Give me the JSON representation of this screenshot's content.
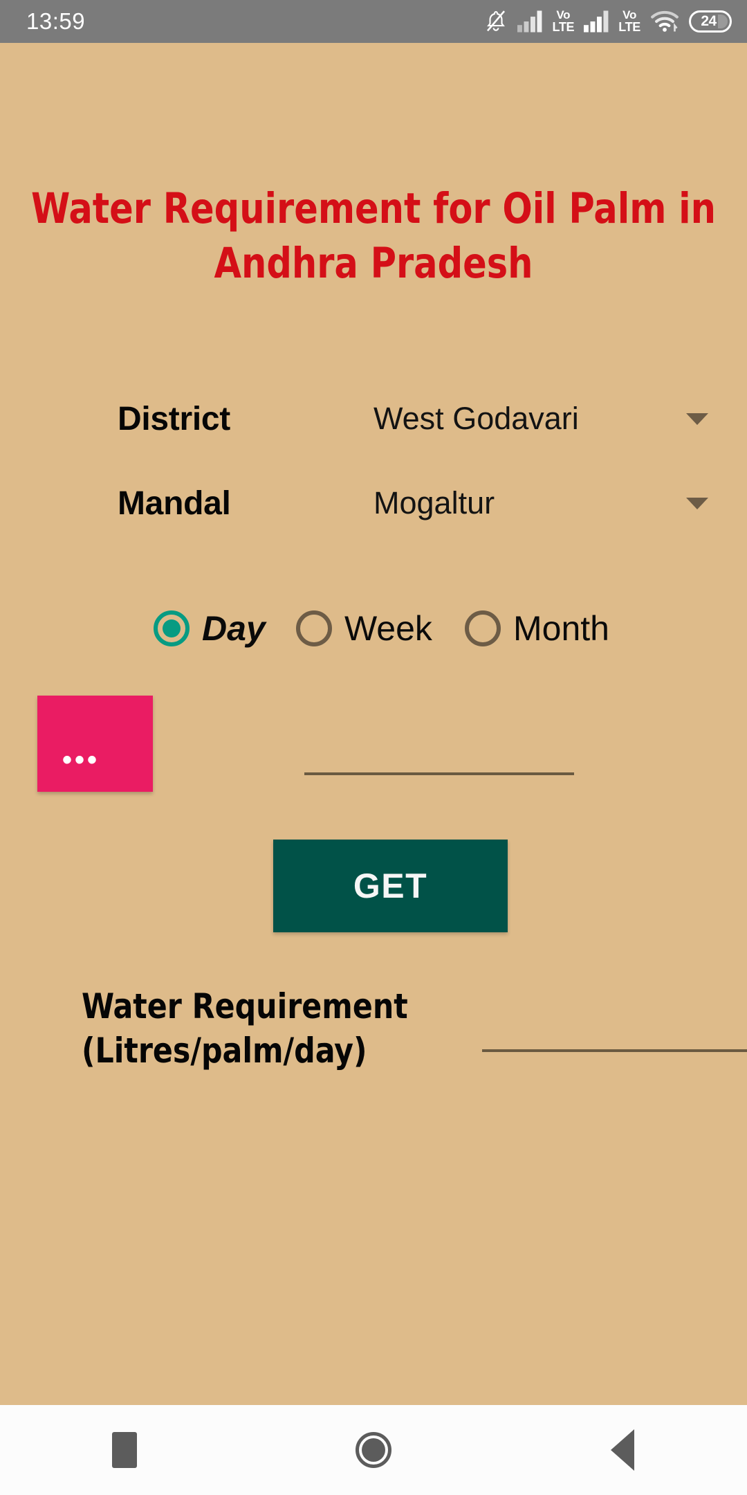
{
  "status_bar": {
    "time": "13:59",
    "battery_level": "24",
    "icons": [
      "bell-muted-icon",
      "signal-bars-icon",
      "volte-icon",
      "signal-bars-icon",
      "volte-icon",
      "wifi-icon",
      "battery-icon"
    ],
    "volte_top": "Vo",
    "volte_bottom": "LTE",
    "background_color": "#7b7b7b"
  },
  "app": {
    "background_color": "#debb8a",
    "title": "Water Requirement for Oil Palm in Andhra Pradesh",
    "title_color": "#d40f17",
    "district": {
      "label": "District",
      "value": "West Godavari"
    },
    "mandal": {
      "label": "Mandal",
      "value": "Mogaltur"
    },
    "period": {
      "selected": "Day",
      "options": [
        {
          "label": "Day",
          "selected": true
        },
        {
          "label": "Week",
          "selected": false
        },
        {
          "label": "Month",
          "selected": false
        }
      ],
      "selected_color": "#079b82"
    },
    "date_picker": {
      "button_label": "•••",
      "button_color": "#ea1c63",
      "field_value": ""
    },
    "get_button": {
      "label": "GET",
      "color": "#015248"
    },
    "result": {
      "label": "Water Requirement (Litres/palm/day)",
      "value": ""
    }
  },
  "nav_bar": {
    "buttons": [
      "recents-button",
      "home-button",
      "back-button"
    ],
    "background_color": "#fcfcfc"
  }
}
